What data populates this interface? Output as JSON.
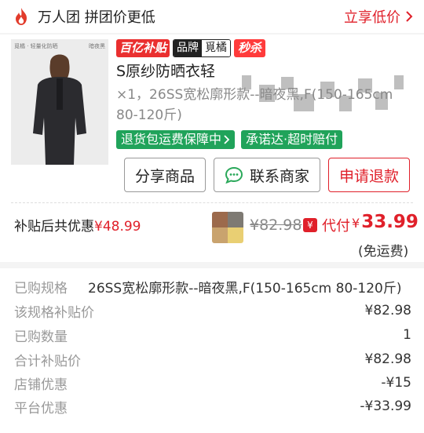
{
  "topbar": {
    "icon": "fire-icon",
    "group_text": "万人团 拼团价更低",
    "share_text": "立享低价"
  },
  "product": {
    "thumb_tag_left": "覓橘 · 轻量化防晒",
    "thumb_tag_right": "暗夜黑",
    "badge_bybt": "百亿补贴",
    "badge_brand_key": "品牌",
    "badge_brand_val": "覓橘",
    "badge_ms": "秒杀",
    "title": "S原纱防晒衣轻",
    "spec": "×1，26SS宽松廓形款--暗夜黑,F(150-165cm 80-120斤)",
    "pill_return": "退货包运费保障中",
    "pill_promise": "承诺达·超时赔付"
  },
  "buttons": {
    "share": "分享商品",
    "contact": "联系商家",
    "refund": "申请退款"
  },
  "price": {
    "subsidy_label": "补贴后共优惠",
    "subsidy_amount": "¥48.99",
    "original": "¥82.98",
    "pay_badge": "¥",
    "pay_label": "代付",
    "pay_currency": "¥",
    "pay_amount": "33.99",
    "free_shipping": "(免运费)"
  },
  "details": [
    {
      "key": "已购规格",
      "value": "26SS宽松廓形款--暗夜黑,F(150-165cm 80-120斤)"
    },
    {
      "key": "该规格补贴价",
      "value": "¥82.98"
    },
    {
      "key": "已购数量",
      "value": "1"
    },
    {
      "key": "合计补贴价",
      "value": "¥82.98"
    },
    {
      "key": "店铺优惠",
      "value": "-¥15"
    },
    {
      "key": "平台优惠",
      "value": "-¥33.99"
    }
  ],
  "colors": {
    "accent_red": "#e0202a",
    "green": "#20a35a"
  }
}
